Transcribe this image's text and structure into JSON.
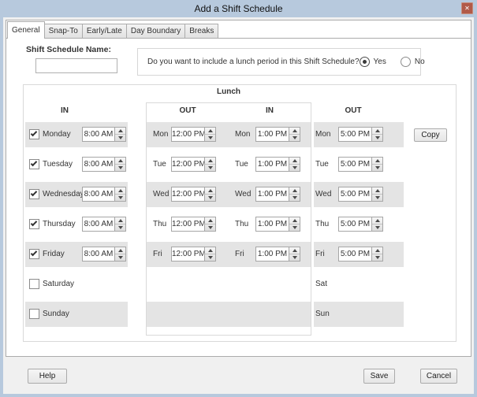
{
  "window": {
    "title": "Add a Shift Schedule",
    "close_glyph": "✕"
  },
  "tabs": [
    {
      "label": "General",
      "active": true
    },
    {
      "label": "Snap-To",
      "active": false
    },
    {
      "label": "Early/Late",
      "active": false
    },
    {
      "label": "Day Boundary",
      "active": false
    },
    {
      "label": "Breaks",
      "active": false
    }
  ],
  "form": {
    "name_label": "Shift Schedule Name:",
    "name_value": "",
    "lunch_question": "Do you want to include a lunch period in this Shift Schedule?",
    "yes_label": "Yes",
    "no_label": "No",
    "lunch_selected": "Yes"
  },
  "grid": {
    "lunch_header": "Lunch",
    "headers": {
      "in": "IN",
      "lunch_out": "OUT",
      "lunch_in": "IN",
      "out": "OUT"
    },
    "copy_label": "Copy",
    "rows": [
      {
        "day": "Monday",
        "abbr": "Mon",
        "checked": true,
        "striped": true,
        "in": "8:00 AM",
        "lunch_out": "12:00 PM",
        "lunch_in": "1:00 PM",
        "out": "5:00 PM"
      },
      {
        "day": "Tuesday",
        "abbr": "Tue",
        "checked": true,
        "striped": false,
        "in": "8:00 AM",
        "lunch_out": "12:00 PM",
        "lunch_in": "1:00 PM",
        "out": "5:00 PM"
      },
      {
        "day": "Wednesday",
        "abbr": "Wed",
        "checked": true,
        "striped": true,
        "in": "8:00 AM",
        "lunch_out": "12:00 PM",
        "lunch_in": "1:00 PM",
        "out": "5:00 PM"
      },
      {
        "day": "Thursday",
        "abbr": "Thu",
        "checked": true,
        "striped": false,
        "in": "8:00 AM",
        "lunch_out": "12:00 PM",
        "lunch_in": "1:00 PM",
        "out": "5:00 PM"
      },
      {
        "day": "Friday",
        "abbr": "Fri",
        "checked": true,
        "striped": true,
        "in": "8:00 AM",
        "lunch_out": "12:00 PM",
        "lunch_in": "1:00 PM",
        "out": "5:00 PM"
      },
      {
        "day": "Saturday",
        "abbr": "Sat",
        "checked": false,
        "striped": false
      },
      {
        "day": "Sunday",
        "abbr": "Sun",
        "checked": false,
        "striped": true
      }
    ]
  },
  "footer": {
    "help_label": "Help",
    "save_label": "Save",
    "cancel_label": "Cancel"
  },
  "colors": {
    "titlebar": "#b7c9dd",
    "close-btn": "#b15a48",
    "stripe": "#e4e4e4"
  }
}
